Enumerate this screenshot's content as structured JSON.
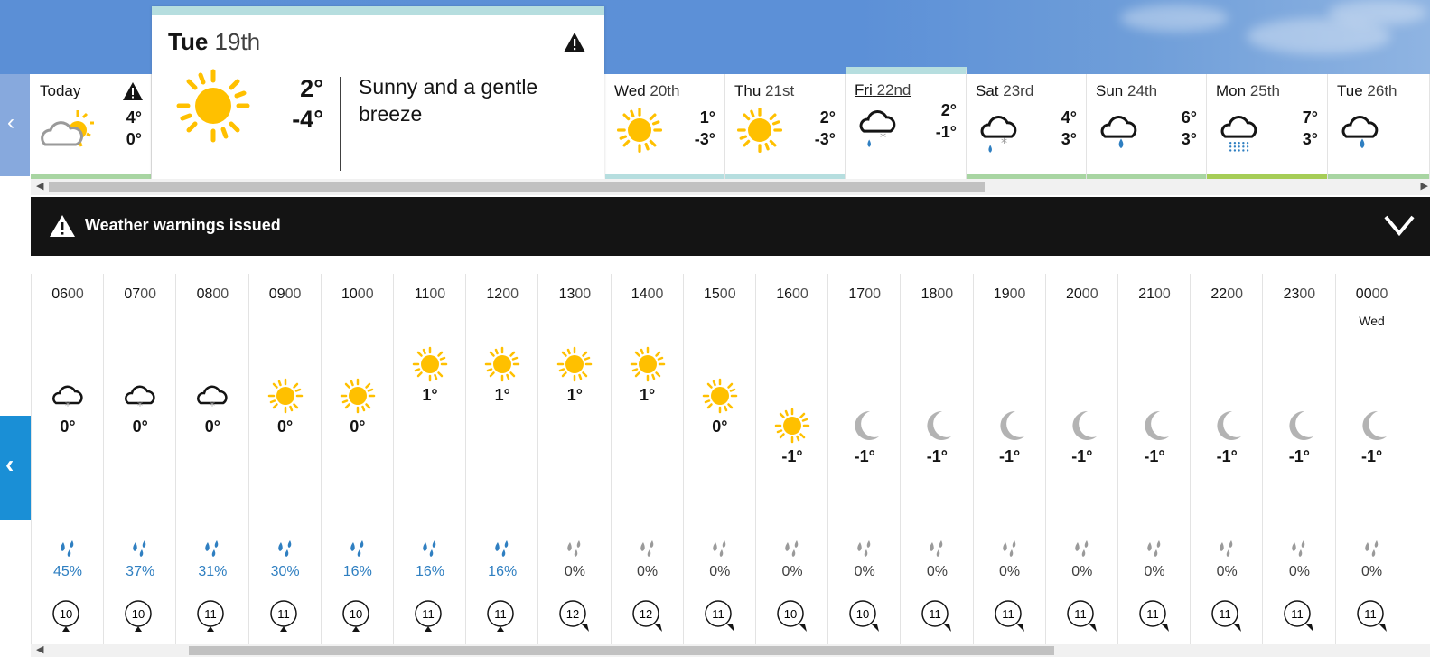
{
  "warning_banner": {
    "text": "Weather warnings issued"
  },
  "today": {
    "label": "Today",
    "high": "4°",
    "low": "0°"
  },
  "selected_day": {
    "day": "Tue",
    "date": "19th",
    "high": "2°",
    "low": "-4°",
    "description": "Sunny and a gentle breeze"
  },
  "days": [
    {
      "day": "Wed",
      "date": "20th",
      "high": "1°",
      "low": "-3°",
      "icon": "sun-icon"
    },
    {
      "day": "Thu",
      "date": "21st",
      "high": "2°",
      "low": "-3°",
      "icon": "sun-icon"
    },
    {
      "day": "Fri",
      "date": "22nd",
      "high": "2°",
      "low": "-1°",
      "icon": "sleet-cloud-icon"
    },
    {
      "day": "Sat",
      "date": "23rd",
      "high": "4°",
      "low": "3°",
      "icon": "sleet-cloud-icon"
    },
    {
      "day": "Sun",
      "date": "24th",
      "high": "6°",
      "low": "3°",
      "icon": "rain-cloud-icon"
    },
    {
      "day": "Mon",
      "date": "25th",
      "high": "7°",
      "low": "3°",
      "icon": "drizzle-cloud-icon"
    },
    {
      "day": "Tue",
      "date": "26th",
      "high": "",
      "low": "",
      "icon": "rain-cloud-icon"
    }
  ],
  "hours": [
    {
      "hh": "06",
      "mm": "00",
      "sub": "",
      "icon": "snow",
      "temp": "0°",
      "rain": "45%",
      "wet": true,
      "wind": "10"
    },
    {
      "hh": "07",
      "mm": "00",
      "sub": "",
      "icon": "snow",
      "temp": "0°",
      "rain": "37%",
      "wet": true,
      "wind": "10"
    },
    {
      "hh": "08",
      "mm": "00",
      "sub": "",
      "icon": "snow",
      "temp": "0°",
      "rain": "31%",
      "wet": true,
      "wind": "11"
    },
    {
      "hh": "09",
      "mm": "00",
      "sub": "",
      "icon": "sun",
      "temp": "0°",
      "rain": "30%",
      "wet": true,
      "wind": "11"
    },
    {
      "hh": "10",
      "mm": "00",
      "sub": "",
      "icon": "sun",
      "temp": "0°",
      "rain": "16%",
      "wet": true,
      "wind": "10"
    },
    {
      "hh": "11",
      "mm": "00",
      "sub": "",
      "icon": "sun",
      "temp": "1°",
      "rain": "16%",
      "wet": true,
      "wind": "11"
    },
    {
      "hh": "12",
      "mm": "00",
      "sub": "",
      "icon": "sun",
      "temp": "1°",
      "rain": "16%",
      "wet": true,
      "wind": "11"
    },
    {
      "hh": "13",
      "mm": "00",
      "sub": "",
      "icon": "sun",
      "temp": "1°",
      "rain": "0%",
      "wet": false,
      "wind": "12"
    },
    {
      "hh": "14",
      "mm": "00",
      "sub": "",
      "icon": "sun",
      "temp": "1°",
      "rain": "0%",
      "wet": false,
      "wind": "12"
    },
    {
      "hh": "15",
      "mm": "00",
      "sub": "",
      "icon": "sun",
      "temp": "0°",
      "rain": "0%",
      "wet": false,
      "wind": "11"
    },
    {
      "hh": "16",
      "mm": "00",
      "sub": "",
      "icon": "sun",
      "temp": "-1°",
      "rain": "0%",
      "wet": false,
      "wind": "10"
    },
    {
      "hh": "17",
      "mm": "00",
      "sub": "",
      "icon": "moon",
      "temp": "-1°",
      "rain": "0%",
      "wet": false,
      "wind": "10"
    },
    {
      "hh": "18",
      "mm": "00",
      "sub": "",
      "icon": "moon",
      "temp": "-1°",
      "rain": "0%",
      "wet": false,
      "wind": "11"
    },
    {
      "hh": "19",
      "mm": "00",
      "sub": "",
      "icon": "moon",
      "temp": "-1°",
      "rain": "0%",
      "wet": false,
      "wind": "11"
    },
    {
      "hh": "20",
      "mm": "00",
      "sub": "",
      "icon": "moon",
      "temp": "-1°",
      "rain": "0%",
      "wet": false,
      "wind": "11"
    },
    {
      "hh": "21",
      "mm": "00",
      "sub": "",
      "icon": "moon",
      "temp": "-1°",
      "rain": "0%",
      "wet": false,
      "wind": "11"
    },
    {
      "hh": "22",
      "mm": "00",
      "sub": "",
      "icon": "moon",
      "temp": "-1°",
      "rain": "0%",
      "wet": false,
      "wind": "11"
    },
    {
      "hh": "23",
      "mm": "00",
      "sub": "",
      "icon": "moon",
      "temp": "-1°",
      "rain": "0%",
      "wet": false,
      "wind": "11"
    },
    {
      "hh": "00",
      "mm": "00",
      "sub": "Wed",
      "icon": "moon",
      "temp": "-1°",
      "rain": "0%",
      "wet": false,
      "wind": "11"
    }
  ],
  "colors": {
    "sun": "#ffc000",
    "rain_blue": "#2f7fc1",
    "dry_grey": "#9a9a9a",
    "accent_blue": "#1a8fd6",
    "banner": "#141414"
  }
}
